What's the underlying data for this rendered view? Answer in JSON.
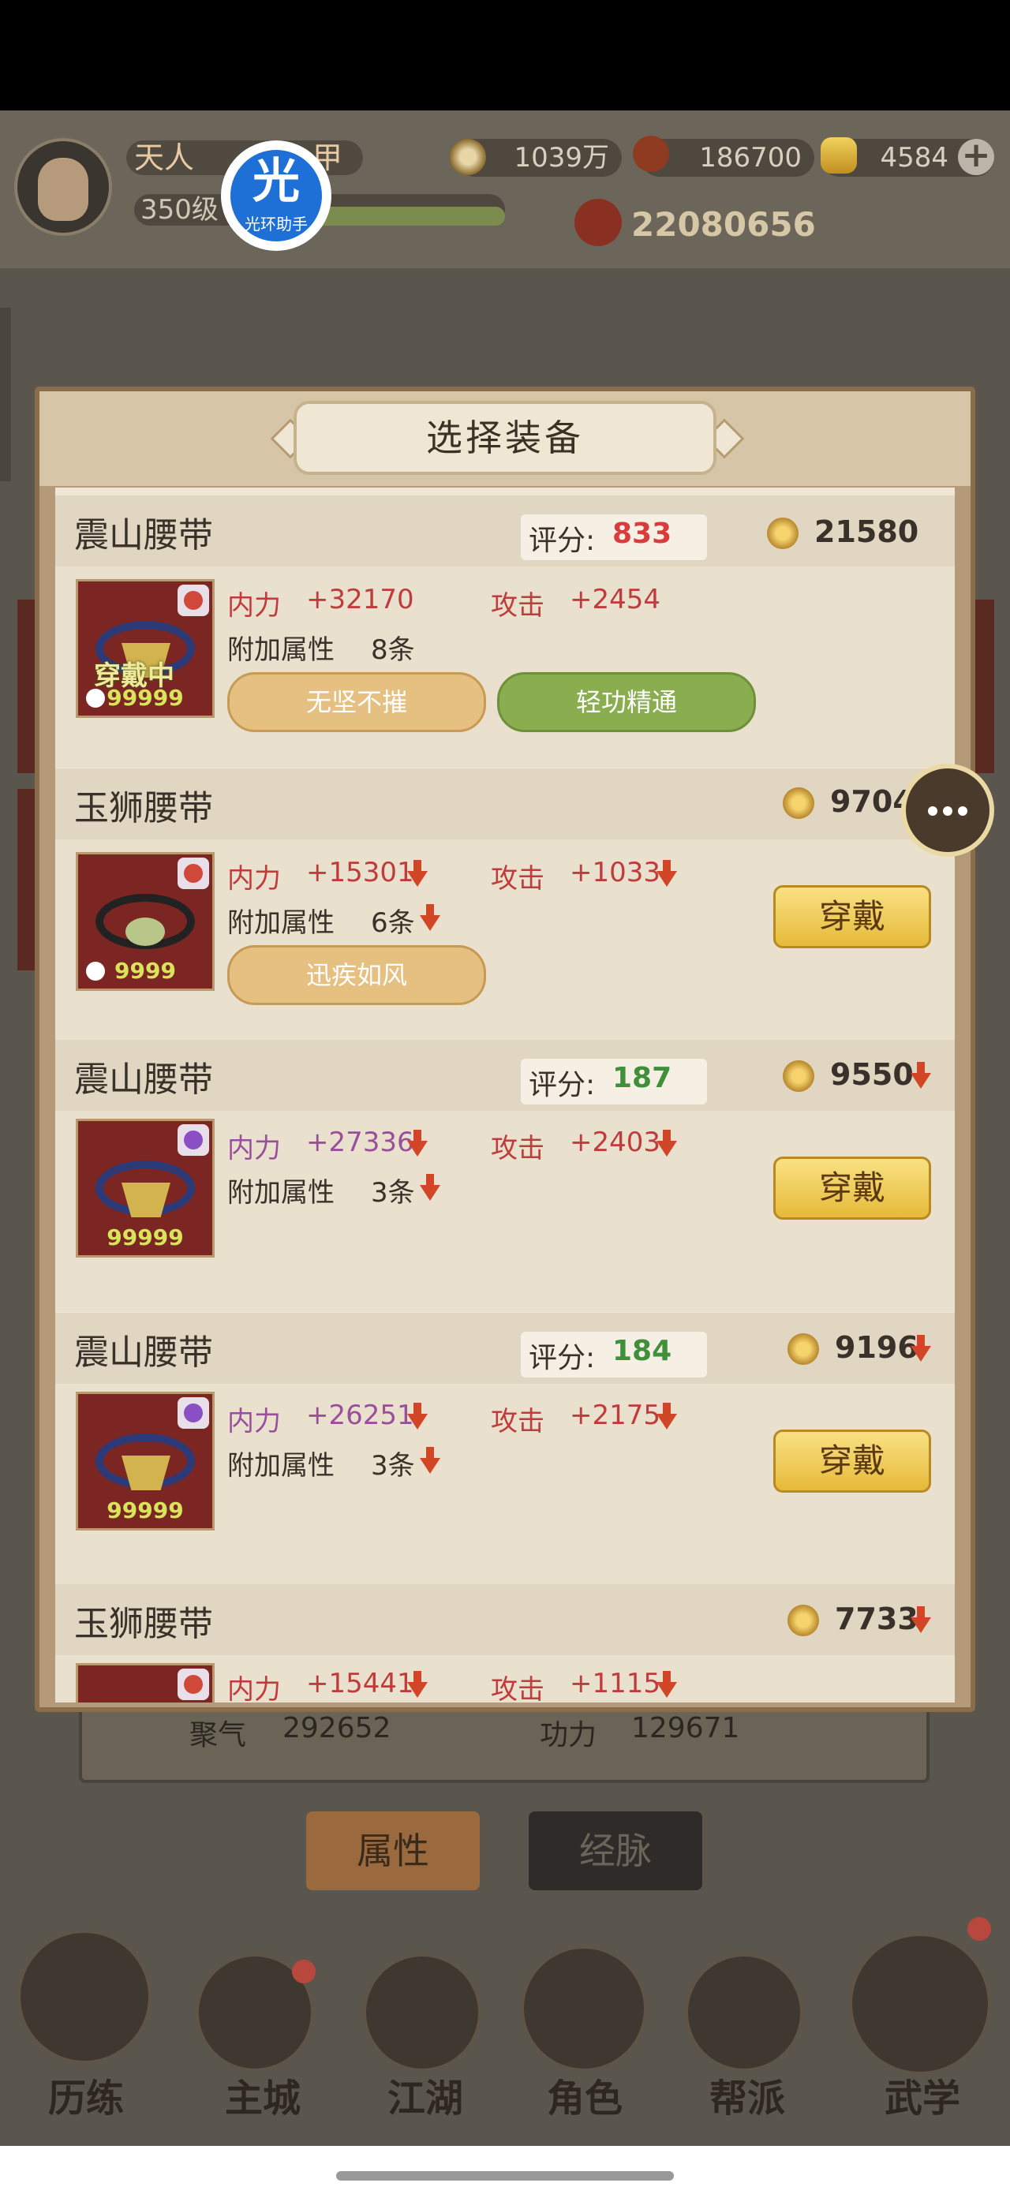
{
  "hud": {
    "rank": "天人",
    "name_fragment": "甲",
    "level": "350级",
    "badge_char": "光",
    "badge_label": "光环助手",
    "copper": "1039万",
    "resource2": "186700",
    "gold": "4584",
    "power": "22080656"
  },
  "modal": {
    "title": "选择装备",
    "items": [
      {
        "name": "震山腰带",
        "score_label": "评分:",
        "score": "833",
        "score_color": "#d83c3c",
        "gear_score": "21580",
        "neili_label": "内力",
        "neili": "+32170",
        "attack_label": "攻击",
        "attack": "+2454",
        "extra_label": "附加属性",
        "extra_count": "8条",
        "tags": [
          "无坚不摧",
          "轻功精通"
        ],
        "wearing_label": "穿戴中",
        "qty": "99999",
        "wear_label": ""
      },
      {
        "name": "玉狮腰带",
        "gear_score": "9704",
        "neili_label": "内力",
        "neili": "+15301",
        "attack_label": "攻击",
        "attack": "+1033",
        "extra_label": "附加属性",
        "extra_count": "6条",
        "tags": [
          "迅疾如风"
        ],
        "qty": "9999",
        "wear_label": "穿戴"
      },
      {
        "name": "震山腰带",
        "score_label": "评分:",
        "score": "187",
        "score_color": "#3f8f3b",
        "gear_score": "9550",
        "neili_label": "内力",
        "neili": "+27336",
        "attack_label": "攻击",
        "attack": "+2403",
        "extra_label": "附加属性",
        "extra_count": "3条",
        "qty": "99999",
        "wear_label": "穿戴"
      },
      {
        "name": "震山腰带",
        "score_label": "评分:",
        "score": "184",
        "score_color": "#3f8f3b",
        "gear_score": "9196",
        "neili_label": "内力",
        "neili": "+26251",
        "attack_label": "攻击",
        "attack": "+2175",
        "extra_label": "附加属性",
        "extra_count": "3条",
        "qty": "99999",
        "wear_label": "穿戴"
      },
      {
        "name": "玉狮腰带",
        "gear_score": "7733",
        "neili_label": "内力",
        "neili": "+15441",
        "attack_label": "攻击",
        "attack": "+1115"
      }
    ]
  },
  "stats": {
    "juqi_label": "聚气",
    "juqi": "292652",
    "gongli_label": "功力",
    "gongli": "129671"
  },
  "tabs": [
    "属性",
    "经脉"
  ],
  "nav": [
    "历练",
    "主城",
    "江湖",
    "角色",
    "帮派",
    "武学"
  ],
  "icons": [
    "copper-coin-icon",
    "gold-ingot-icon",
    "power-icon",
    "gear-score-icon",
    "chat-icon",
    "down-arrow-icon",
    "lock-icon",
    "plus-icon"
  ]
}
